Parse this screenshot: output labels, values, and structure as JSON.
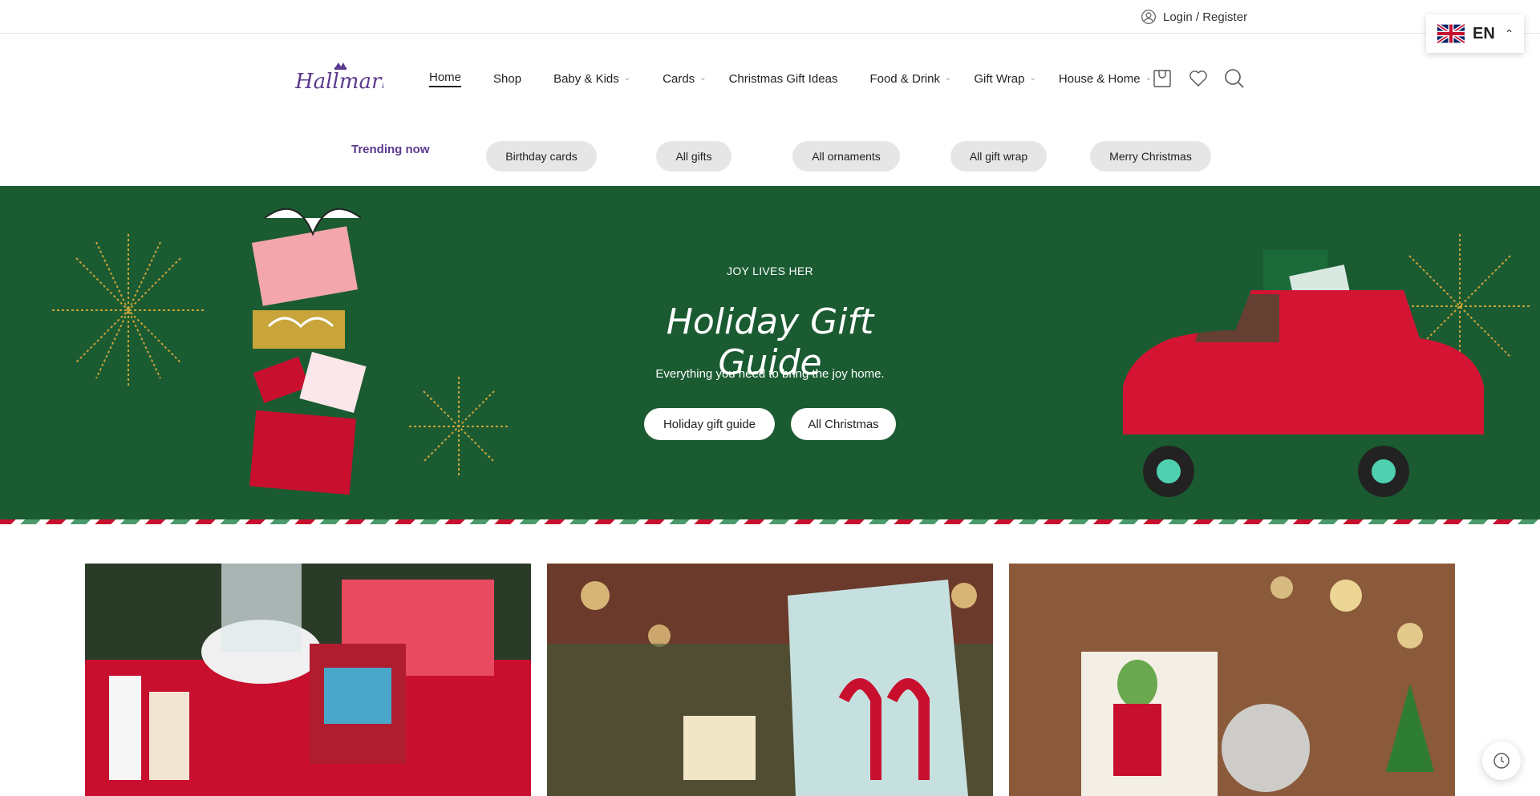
{
  "topbar": {
    "login_label": "Login / Register"
  },
  "language": {
    "code": "EN"
  },
  "nav": {
    "home": "Home",
    "shop": "Shop",
    "baby_kids": "Baby & Kids",
    "cards": "Cards",
    "christmas_gift_ideas": "Christmas Gift Ideas",
    "food_drink": "Food & Drink",
    "gift_wrap": "Gift Wrap",
    "house_home": "House & Home"
  },
  "icons": [
    "user-icon",
    "cart-icon",
    "heart-icon",
    "search-icon",
    "chevron-down-icon",
    "history-icon"
  ],
  "trending": {
    "label": "Trending now",
    "pills": [
      "Birthday cards",
      "All gifts",
      "All ornaments",
      "All gift wrap",
      "Merry Christmas"
    ]
  },
  "hero": {
    "eyebrow": "JOY LIVES HER",
    "title": "Holiday Gift Guide",
    "subtitle": "Everything you need to bring the joy home.",
    "button_primary": "Holiday gift guide",
    "button_secondary": "All Christmas"
  },
  "colors": {
    "hero_bg": "#1b5b32",
    "trending_label": "#5b3a8f",
    "brand": "#5b3a8f",
    "pill_bg": "#e6e6e6"
  }
}
